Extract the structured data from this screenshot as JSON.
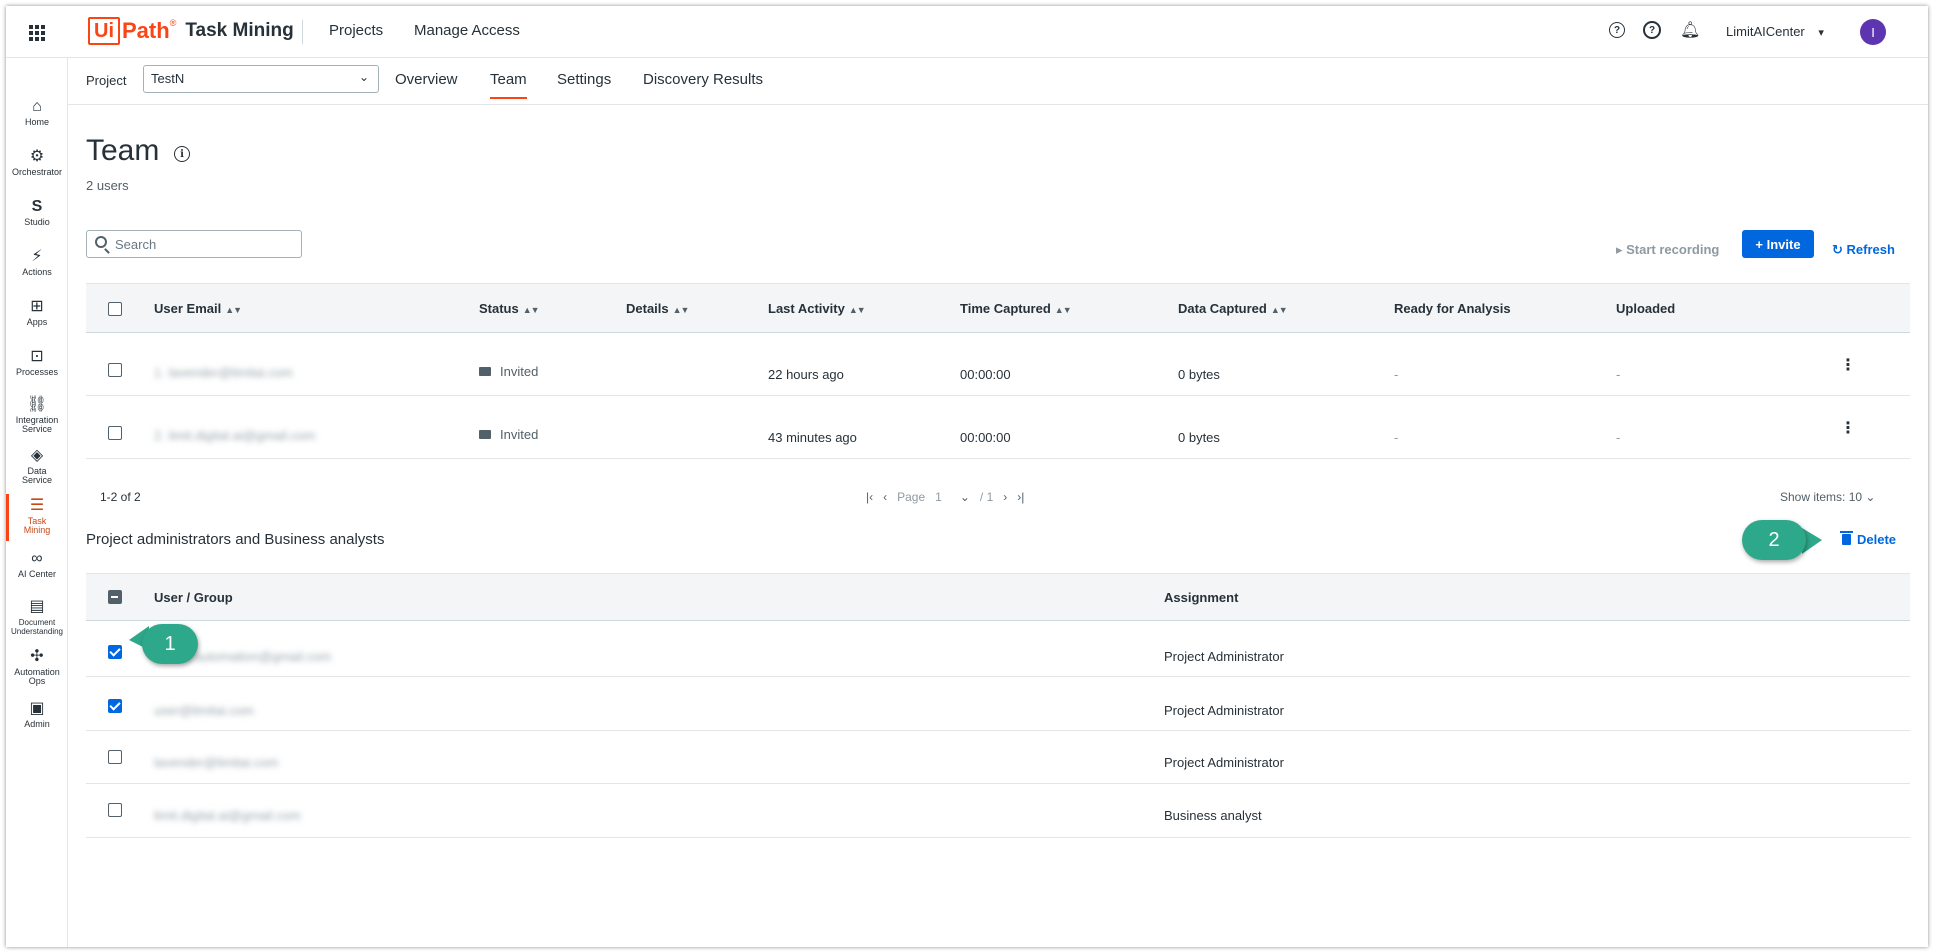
{
  "header": {
    "logo_box": "Ui",
    "logo_path": "Path",
    "logo_reg": "®",
    "product": "Task Mining",
    "nav": [
      "Projects",
      "Manage Access"
    ],
    "help_glyph": "?",
    "tenant": "LimitAICenter",
    "tenant_chevron": "▾",
    "avatar_initial": "I"
  },
  "rail": [
    {
      "label": "Home",
      "icon": "home-icon",
      "glyph": "⌂"
    },
    {
      "label": "Orchestrator",
      "icon": "orchestrator-icon",
      "glyph": "⚙"
    },
    {
      "label": "Studio",
      "icon": "studio-icon",
      "glyph": "S"
    },
    {
      "label": "Actions",
      "icon": "actions-icon",
      "glyph": "⚡"
    },
    {
      "label": "Apps",
      "icon": "apps-icon",
      "glyph": "⊞"
    },
    {
      "label": "Processes",
      "icon": "processes-icon",
      "glyph": "⊡"
    },
    {
      "label": "Integration Service",
      "icon": "integration-icon",
      "glyph": "⛓"
    },
    {
      "label": "Data Service",
      "icon": "data-service-icon",
      "glyph": "◈"
    },
    {
      "label": "Task Mining",
      "icon": "task-mining-icon",
      "glyph": "☰"
    },
    {
      "label": "AI Center",
      "icon": "ai-center-icon",
      "glyph": "∞"
    },
    {
      "label": "Document Understanding",
      "icon": "document-icon",
      "glyph": "▤"
    },
    {
      "label": "Automation Ops",
      "icon": "automation-ops-icon",
      "glyph": "✣"
    },
    {
      "label": "Admin",
      "icon": "admin-icon",
      "glyph": "▣"
    }
  ],
  "subnav": {
    "project_label": "Project",
    "project_value": "TestN",
    "tabs": [
      "Overview",
      "Team",
      "Settings",
      "Discovery Results"
    ],
    "active_tab": "Team"
  },
  "page": {
    "title": "Team",
    "info_glyph": "i",
    "user_count": "2 users",
    "search_placeholder": "Search",
    "start_recording": "▸  Start recording",
    "invite": "+ Invite",
    "refresh": "↻ Refresh"
  },
  "users_table": {
    "columns": [
      "User Email",
      "Status",
      "Details",
      "Last Activity",
      "Time Captured",
      "Data Captured",
      "Ready for Analysis",
      "Uploaded"
    ],
    "sort_glyph": "▲▼",
    "rows": [
      {
        "email": "1. lavender@limitai.com",
        "status": "Invited",
        "last_activity": "22 hours ago",
        "time": "00:00:00",
        "data": "0 bytes",
        "ready": "-",
        "uploaded": "-"
      },
      {
        "email": "2. limit.digital.ai@gmail.com",
        "status": "Invited",
        "last_activity": "43 minutes ago",
        "time": "00:00:00",
        "data": "0 bytes",
        "ready": "-",
        "uploaded": "-"
      }
    ],
    "kebab": "⋮",
    "range": "1-2 of 2",
    "pager": {
      "first": "|‹",
      "prev": "‹",
      "page_label": "Page",
      "page": "1",
      "dropdown": "⌄",
      "total": "/ 1",
      "next": "›",
      "last": "›|"
    },
    "show_items": "Show items: 10  ⌄"
  },
  "admins": {
    "title": "Project administrators and Business analysts",
    "delete": "Delete",
    "columns": [
      "User / Group",
      "Assignment"
    ],
    "rows": [
      {
        "user": "limit.ai.automation@gmail.com",
        "assignment": "Project Administrator",
        "checked": true
      },
      {
        "user": "user@limitai.com",
        "assignment": "Project Administrator",
        "checked": true
      },
      {
        "user": "lavender@limitai.com",
        "assignment": "Project Administrator",
        "checked": false
      },
      {
        "user": "limit.digital.ai@gmail.com",
        "assignment": "Business analyst",
        "checked": false
      }
    ]
  },
  "callouts": [
    "1",
    "2"
  ],
  "colors": {
    "accent": "#0067df",
    "brand": "#fa4616",
    "callout": "#2ea88a",
    "avatar": "#5e35b1"
  }
}
